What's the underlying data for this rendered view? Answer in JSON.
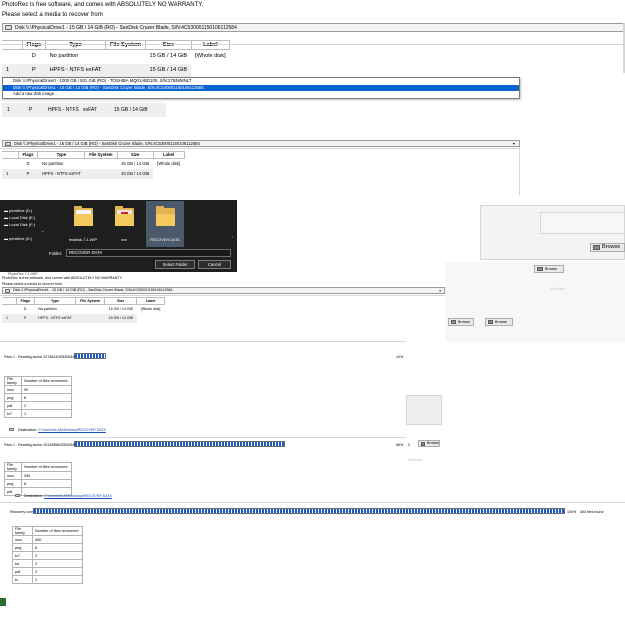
{
  "panel1": {
    "intro": "PhotoRec is free software, and comes with ABSOLUTELY NO WARRANTY.",
    "prompt": "Please select a media to recover from",
    "disk_select": "Disk \\\\.\\PhysicalDrive1 - 15 GB / 14 GiB (RO) - SanDisk Cruzer Blade, S/N:4C530001150106112584",
    "headers": [
      "Flags",
      "Type",
      "File System",
      "Size",
      "Label"
    ],
    "rows": [
      {
        "num": "",
        "flags": "D",
        "type": "No partition",
        "fs": "",
        "size": "15 GB / 14 GiB",
        "label": "[Whole disk]"
      },
      {
        "num": "1",
        "flags": "P",
        "type": "HPFS - NTFS",
        "fs": "exFAT",
        "size": "15 GB / 14 GiB",
        "label": ""
      }
    ]
  },
  "dropdown": {
    "items": [
      "Disk \\\\.\\PhysicalDrive0 - 1000 GB / 931 GiB (RO) - TOSHIBA MQ01ABD100, S/N:27BNIMNLT",
      "Disk \\\\.\\PhysicalDrive1 - 15 GB / 14 GiB (RO) - SanDisk Cruzer Blade, S/N:4C530001150106112584",
      "Add a raw disk image..."
    ],
    "selected_index": 1,
    "row_below": {
      "num": "1",
      "flags": "P",
      "type": "HPFS - NTFS",
      "fs": "exFAT",
      "size": "15 GB / 14 GiB"
    }
  },
  "panel2": {
    "disk_select": "Disk \\\\.\\PhysicalDrive1 - 15 GB / 14 GiB (RO) - SanDisk Cruzer Blade, S/N:4C530001150106112584",
    "headers": [
      "Flags",
      "Type",
      "File System",
      "Size",
      "Label"
    ],
    "rows": [
      {
        "num": "",
        "flags": "D",
        "type": "No partition",
        "fs": "",
        "size": "15 GB / 14 GiB",
        "label": "[Whole disk]"
      },
      {
        "num": "1",
        "flags": "P",
        "type": "HPFS - NTFS",
        "fs": "exFAT",
        "size": "15 GB / 14 GiB",
        "label": ""
      }
    ]
  },
  "folder_dialog": {
    "sidebar": [
      "pendrive (D:)",
      "Local Disk (E:)",
      "Local Disk (F:)",
      "pendrive (D:)"
    ],
    "folders": [
      {
        "name": "testdisk-7.1-WIP",
        "kind": "plain"
      },
      {
        "name": "xxx",
        "kind": "red"
      },
      {
        "name": "RECOVER DATA",
        "kind": "selected"
      }
    ],
    "folder_label": "Folder:",
    "folder_value": "RECOVER DATA",
    "select_button": "Select Folder",
    "cancel_button": "Cancel"
  },
  "browse_label": "Browse",
  "faint_text": "Windows",
  "panel3": {
    "title": "PhotoRec 7.1-WIP",
    "intro": "PhotoRec is free software, and comes with ABSOLUTELY NO WARRANTY.",
    "prompt": "Please select a media to recover from",
    "disk_select": "Disk \\\\.\\PhysicalDrive1 - 15 GB / 14 GiB (RO) - SanDisk Cruzer Blade, S/N:4C530001150106112584",
    "headers": [
      "Flags",
      "Type",
      "File System",
      "Size",
      "Label"
    ],
    "rows": [
      {
        "num": "",
        "flags": "D",
        "type": "No partition",
        "fs": "",
        "size": "15 GB / 14 GiB",
        "label": "[Whole disk]"
      },
      {
        "num": "1",
        "flags": "P",
        "type": "HPFS - NTFS",
        "fs": "exFAT",
        "size": "15 GB / 14 GiB",
        "label": ""
      }
    ]
  },
  "progress1": {
    "text": "Pass 1 - Reading sector 3274624/30530544",
    "percent_label": "10%",
    "fraction": 0.1
  },
  "grid1": {
    "headers": [
      "File family",
      "Number of files recovered"
    ],
    "rows": [
      [
        "mov",
        "90"
      ],
      [
        "png",
        "8"
      ],
      [
        "pdf",
        "2"
      ],
      [
        "tx?",
        "1"
      ]
    ]
  },
  "destination1": {
    "label": "Destination:",
    "path": "C:\\Users\\ALAM\\Desktop\\RECOVER DATA"
  },
  "progress2": {
    "text": "Pass 1 - Reading sector 20149856/30530544",
    "percent_label": "66%",
    "fraction": 0.66,
    "extra": "2"
  },
  "grid2": {
    "headers": [
      "File family",
      "Number of files recovered"
    ],
    "rows": [
      [
        "mov",
        "299"
      ],
      [
        "png",
        "8"
      ],
      [
        "pdf",
        ""
      ]
    ]
  },
  "destination2": {
    "label": "Destination:",
    "path": "C:\\Users\\ALAM\\Desktop\\RECOVER DATA"
  },
  "progress3": {
    "text": "Recovery completed",
    "percent_label": "100%",
    "files_label": "464 files found",
    "fraction": 1.0
  },
  "grid3": {
    "headers": [
      "File family",
      "Number of files recovered"
    ],
    "rows": [
      [
        "mov",
        "450"
      ],
      [
        "png",
        "6"
      ],
      [
        "tx?",
        "2"
      ],
      [
        "txt",
        "2"
      ],
      [
        "pdf",
        "2"
      ],
      [
        "tx",
        "1"
      ]
    ]
  }
}
